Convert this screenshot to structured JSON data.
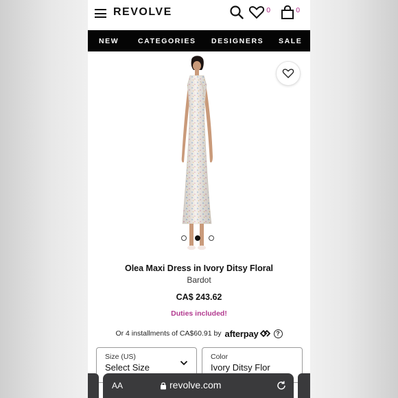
{
  "header": {
    "logo_text": "REVOLVE",
    "wishlist_count": "0",
    "cart_count": "0",
    "icons": [
      "menu-icon",
      "search-icon",
      "heart-icon",
      "bag-icon"
    ]
  },
  "nav": {
    "items": [
      {
        "label": "NEW"
      },
      {
        "label": "CATEGORIES"
      },
      {
        "label": "DESIGNERS"
      },
      {
        "label": "SALE"
      }
    ]
  },
  "gallery": {
    "image_count": 3,
    "active_index": 1
  },
  "product": {
    "title": "Olea Maxi Dress in Ivory Ditsy Floral",
    "brand": "Bardot",
    "price": "CA$ 243.62",
    "duties_note": "Duties included!",
    "installments_text": "Or 4 installments of CA$60.91 by",
    "installments_brand": "afterpay",
    "info_icon_text": "?"
  },
  "selectors": {
    "size": {
      "label": "Size (US)",
      "value": "Select Size"
    },
    "color": {
      "label": "Color",
      "value": "Ivory Ditsy Flor"
    }
  },
  "browser": {
    "text_size_label": "AA",
    "url": "revolve.com"
  },
  "colors": {
    "accent_pink": "#b23a8f",
    "nav_bg": "#050505",
    "browser_bar": "#3a3a3c"
  }
}
